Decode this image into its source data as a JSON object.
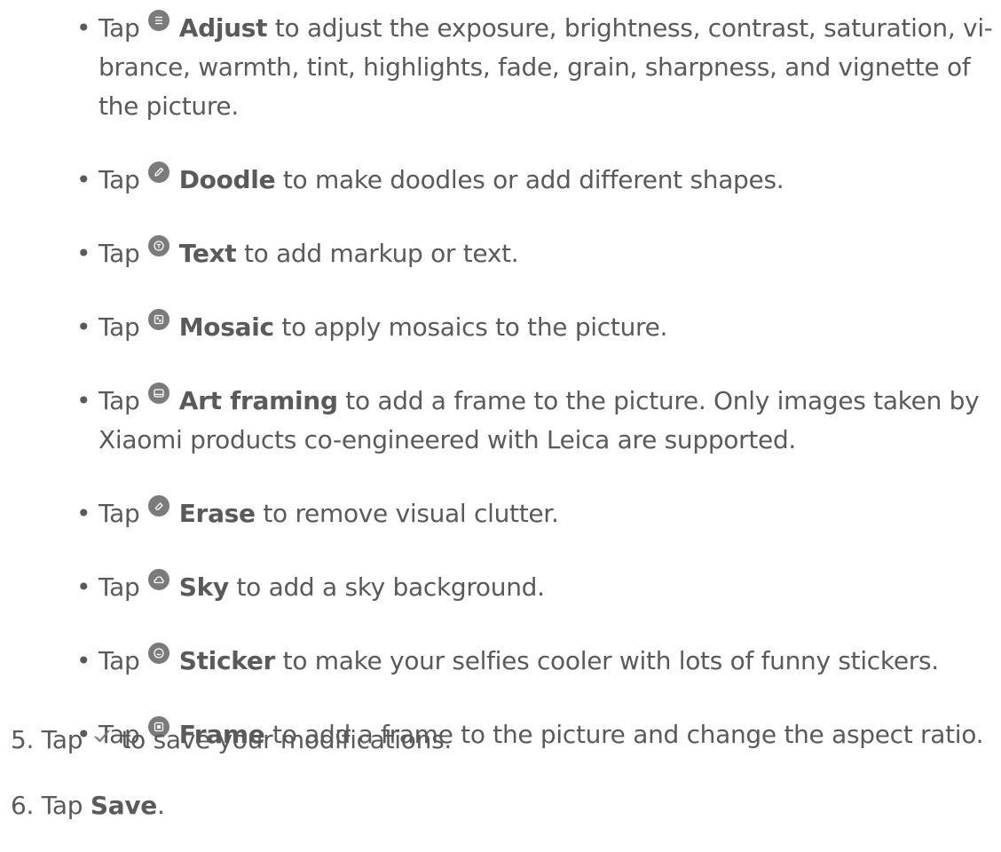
{
  "bullets": [
    {
      "prefix": "Tap",
      "icon": "adjust-icon",
      "term": "Adjust",
      "line1": " to adjust the exposure, brightness, contrast, saturation, vi-",
      "line2": "brance, warmth, tint, highlights, fade, grain, sharpness, and vignette of",
      "line3": "the picture."
    },
    {
      "prefix": "Tap",
      "icon": "doodle-icon",
      "term": "Doodle",
      "line1": " to make doodles or add different shapes."
    },
    {
      "prefix": "Tap",
      "icon": "text-icon",
      "term": "Text",
      "line1": " to add markup or text."
    },
    {
      "prefix": "Tap",
      "icon": "mosaic-icon",
      "term": "Mosaic",
      "line1": " to apply mosaics to the picture."
    },
    {
      "prefix": "Tap",
      "icon": "art-framing-icon",
      "term": "Art framing",
      "line1": " to add a frame to the picture. Only images taken by",
      "line2": "Xiaomi products co-engineered with Leica are supported."
    },
    {
      "prefix": "Tap",
      "icon": "erase-icon",
      "term": "Erase",
      "line1": " to remove visual clutter."
    },
    {
      "prefix": "Tap",
      "icon": "sky-icon",
      "term": "Sky",
      "line1": " to add a sky background."
    },
    {
      "prefix": "Tap",
      "icon": "sticker-icon",
      "term": "Sticker",
      "line1": " to make your selfies cooler with lots of funny stickers."
    },
    {
      "prefix": "Tap",
      "icon": "frame-icon",
      "term": "Frame",
      "line1": " to add a frame to the picture and change the aspect ratio."
    }
  ],
  "steps": [
    {
      "number": "5.",
      "before": "Tap",
      "icon": "checkmark-icon",
      "after": "to save your modifications."
    },
    {
      "number": "6.",
      "before": "Tap",
      "term": "Save",
      "after": "."
    }
  ]
}
